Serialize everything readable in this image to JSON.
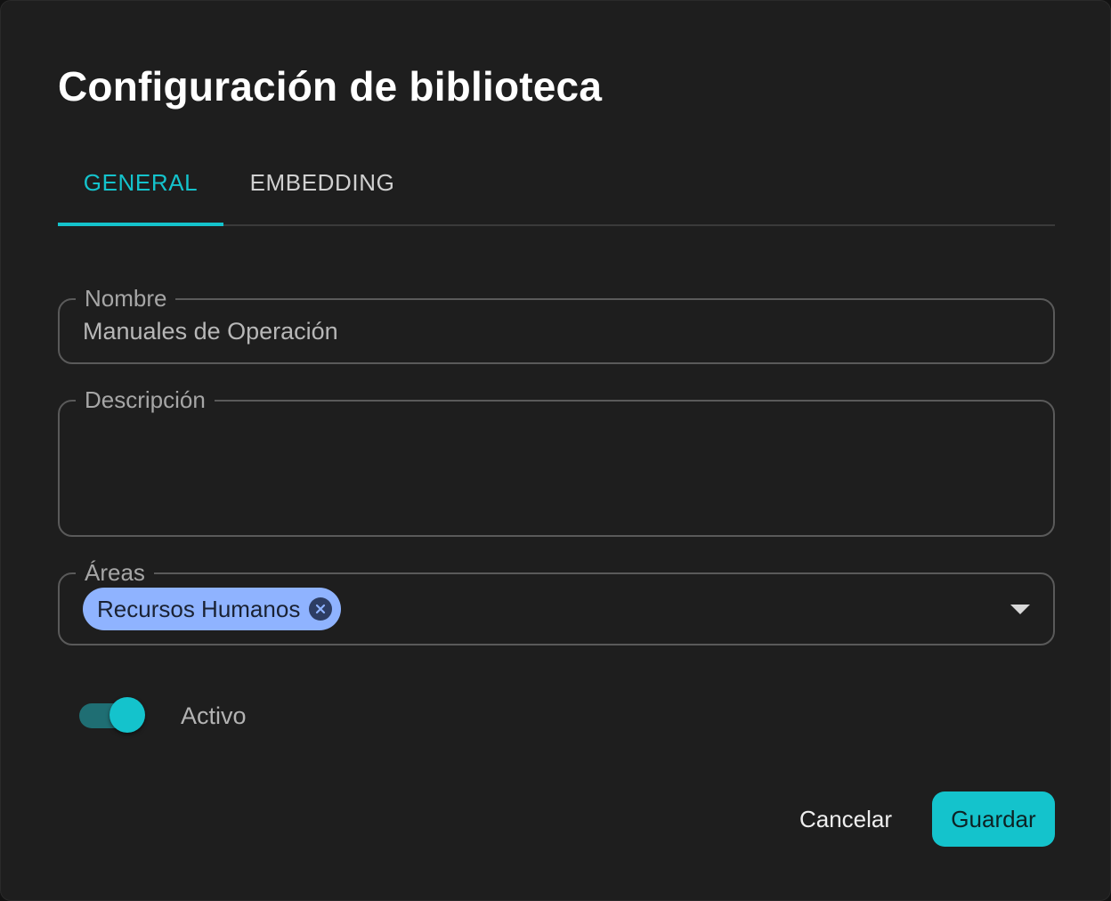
{
  "dialog": {
    "title": "Configuración de biblioteca"
  },
  "tabs": [
    {
      "label": "GENERAL",
      "active": true
    },
    {
      "label": "EMBEDDING",
      "active": false
    }
  ],
  "form": {
    "nombre": {
      "label": "Nombre",
      "value": "Manuales de Operación"
    },
    "descripcion": {
      "label": "Descripción",
      "value": ""
    },
    "areas": {
      "label": "Áreas",
      "chips": [
        "Recursos Humanos"
      ]
    },
    "activo": {
      "label": "Activo",
      "checked": true
    }
  },
  "actions": {
    "cancel_label": "Cancelar",
    "save_label": "Guardar"
  },
  "colors": {
    "accent": "#14c3cc",
    "background": "#1e1e1e",
    "chip": "#8fb3ff"
  },
  "icons": {
    "chip_remove": "close-circle-icon",
    "dropdown": "caret-down-icon"
  }
}
